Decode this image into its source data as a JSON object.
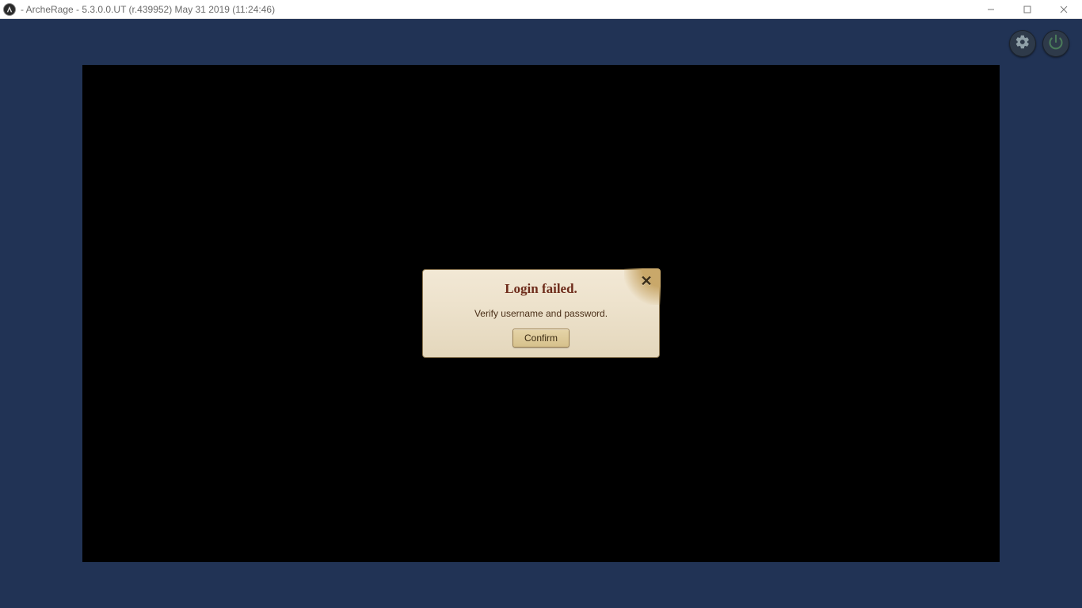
{
  "window": {
    "title": "- ArcheRage - 5.3.0.0.UT (r.439952) May 31 2019 (11:24:46)"
  },
  "dialog": {
    "title": "Login failed.",
    "message": "Verify username and password.",
    "confirm_label": "Confirm"
  }
}
